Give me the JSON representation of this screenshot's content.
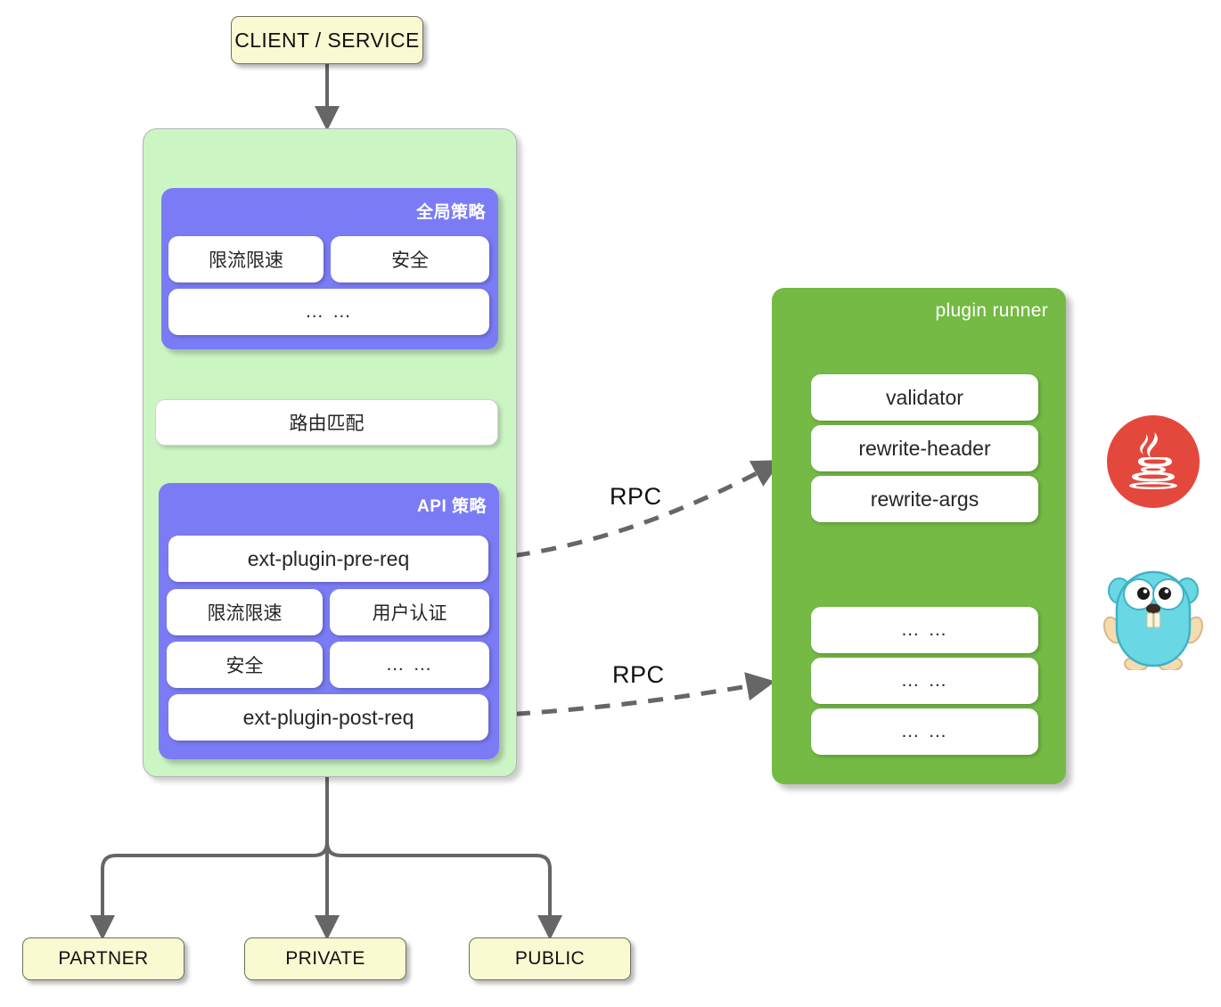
{
  "diagram": {
    "title_box": {
      "label": "CLIENT / SERVICE"
    },
    "gateway": {
      "global_policy": {
        "title": "全局策略",
        "items": [
          "限流限速",
          "安全",
          "… …"
        ]
      },
      "route_match": {
        "label": "路由匹配"
      },
      "api_policy": {
        "title": "API 策略",
        "pre_hook": "ext-plugin-pre-req",
        "items": [
          "限流限速",
          "用户认证",
          "安全",
          "… …"
        ],
        "post_hook": "ext-plugin-post-req"
      }
    },
    "plugin_runner": {
      "title": "plugin runner",
      "group_top": [
        "validator",
        "rewrite-header",
        "rewrite-args"
      ],
      "group_bottom": [
        "… …",
        "… …",
        "… …"
      ]
    },
    "connectors": {
      "rpc_upper": "RPC",
      "rpc_lower": "RPC"
    },
    "targets": [
      {
        "label": "PARTNER"
      },
      {
        "label": "PRIVATE"
      },
      {
        "label": "PUBLIC"
      }
    ],
    "logos": [
      {
        "name": "java-logo"
      },
      {
        "name": "go-gopher-logo"
      }
    ],
    "colors": {
      "yellow_box": "#fafad2",
      "gateway_green": "#ccf5c4",
      "policy_purple": "#7b7cf5",
      "runner_green": "#74ba45",
      "arrow_gray": "#666666",
      "brace_teal": "#1f5560",
      "java_red": "#e4483c",
      "gopher_blue": "#6ad7e5"
    }
  }
}
